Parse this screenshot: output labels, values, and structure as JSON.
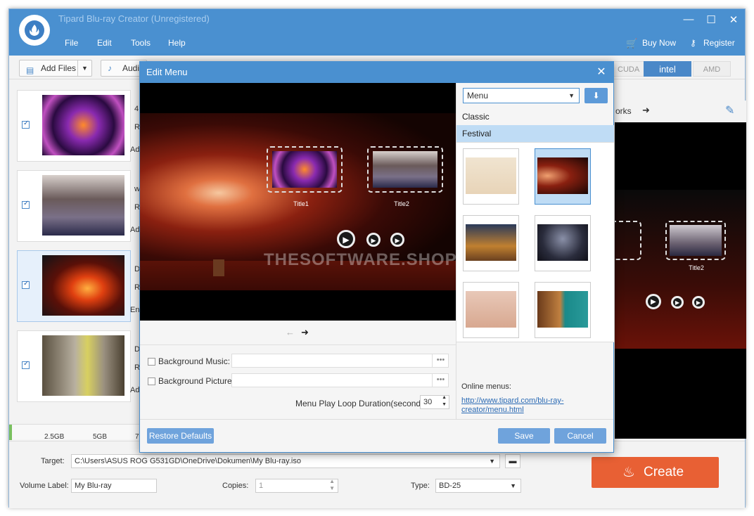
{
  "window": {
    "title": "Tipard Blu-ray Creator (Unregistered)",
    "menu": [
      "File",
      "Edit",
      "Tools",
      "Help"
    ],
    "buy_label": "Buy Now",
    "register_label": "Register",
    "minimize": "—",
    "maximize": "☐",
    "close": "✕"
  },
  "toolbar": {
    "add_files": "Add Files",
    "audio": "Audio",
    "accel": [
      "CUDA",
      "intel",
      "AMD"
    ]
  },
  "videos": [
    {
      "line1": "4",
      "line2": "R",
      "line3": "Ad"
    },
    {
      "line1": "w",
      "line2": "R",
      "line3": "Ad"
    },
    {
      "line1": "D",
      "line2": "R",
      "line3": "En"
    },
    {
      "line1": "D",
      "line2": "R",
      "line3": "Ad"
    }
  ],
  "preview": {
    "label": "orks",
    "title2": "Title2"
  },
  "size_ticks": [
    "2.5GB",
    "5GB",
    "7."
  ],
  "bottom": {
    "target_label": "Target:",
    "target_value": "C:\\Users\\ASUS ROG G531GD\\OneDrive\\Dokumen\\My Blu-ray.iso",
    "volume_label": "Volume Label:",
    "volume_value": "My Blu-ray",
    "copies_label": "Copies:",
    "copies_value": "1",
    "type_label": "Type:",
    "type_value": "BD-25",
    "create_label": "Create"
  },
  "dialog": {
    "title": "Edit Menu",
    "close": "✕",
    "title1": "Title1",
    "title2": "Title2",
    "watermark": "THESOFTWARE.SHOP",
    "bg_music_label": "Background Music:",
    "bg_picture_label": "Background Picture:",
    "dots": "•••",
    "loop_label": "Menu Play Loop Duration(seconds):",
    "loop_value": "30",
    "menu_select": "Menu",
    "categories": [
      "Classic",
      "Festival"
    ],
    "online_label": "Online menus:",
    "online_link1": "http://www.tipard.com/blu-ray-",
    "online_link2": "creator/menu.html",
    "restore_label": "Restore Defaults",
    "save_label": "Save",
    "cancel_label": "Cancel"
  },
  "colors": {
    "accent": "#4a90d0",
    "create": "#e86034",
    "selected_bg": "#bfdcf5"
  }
}
